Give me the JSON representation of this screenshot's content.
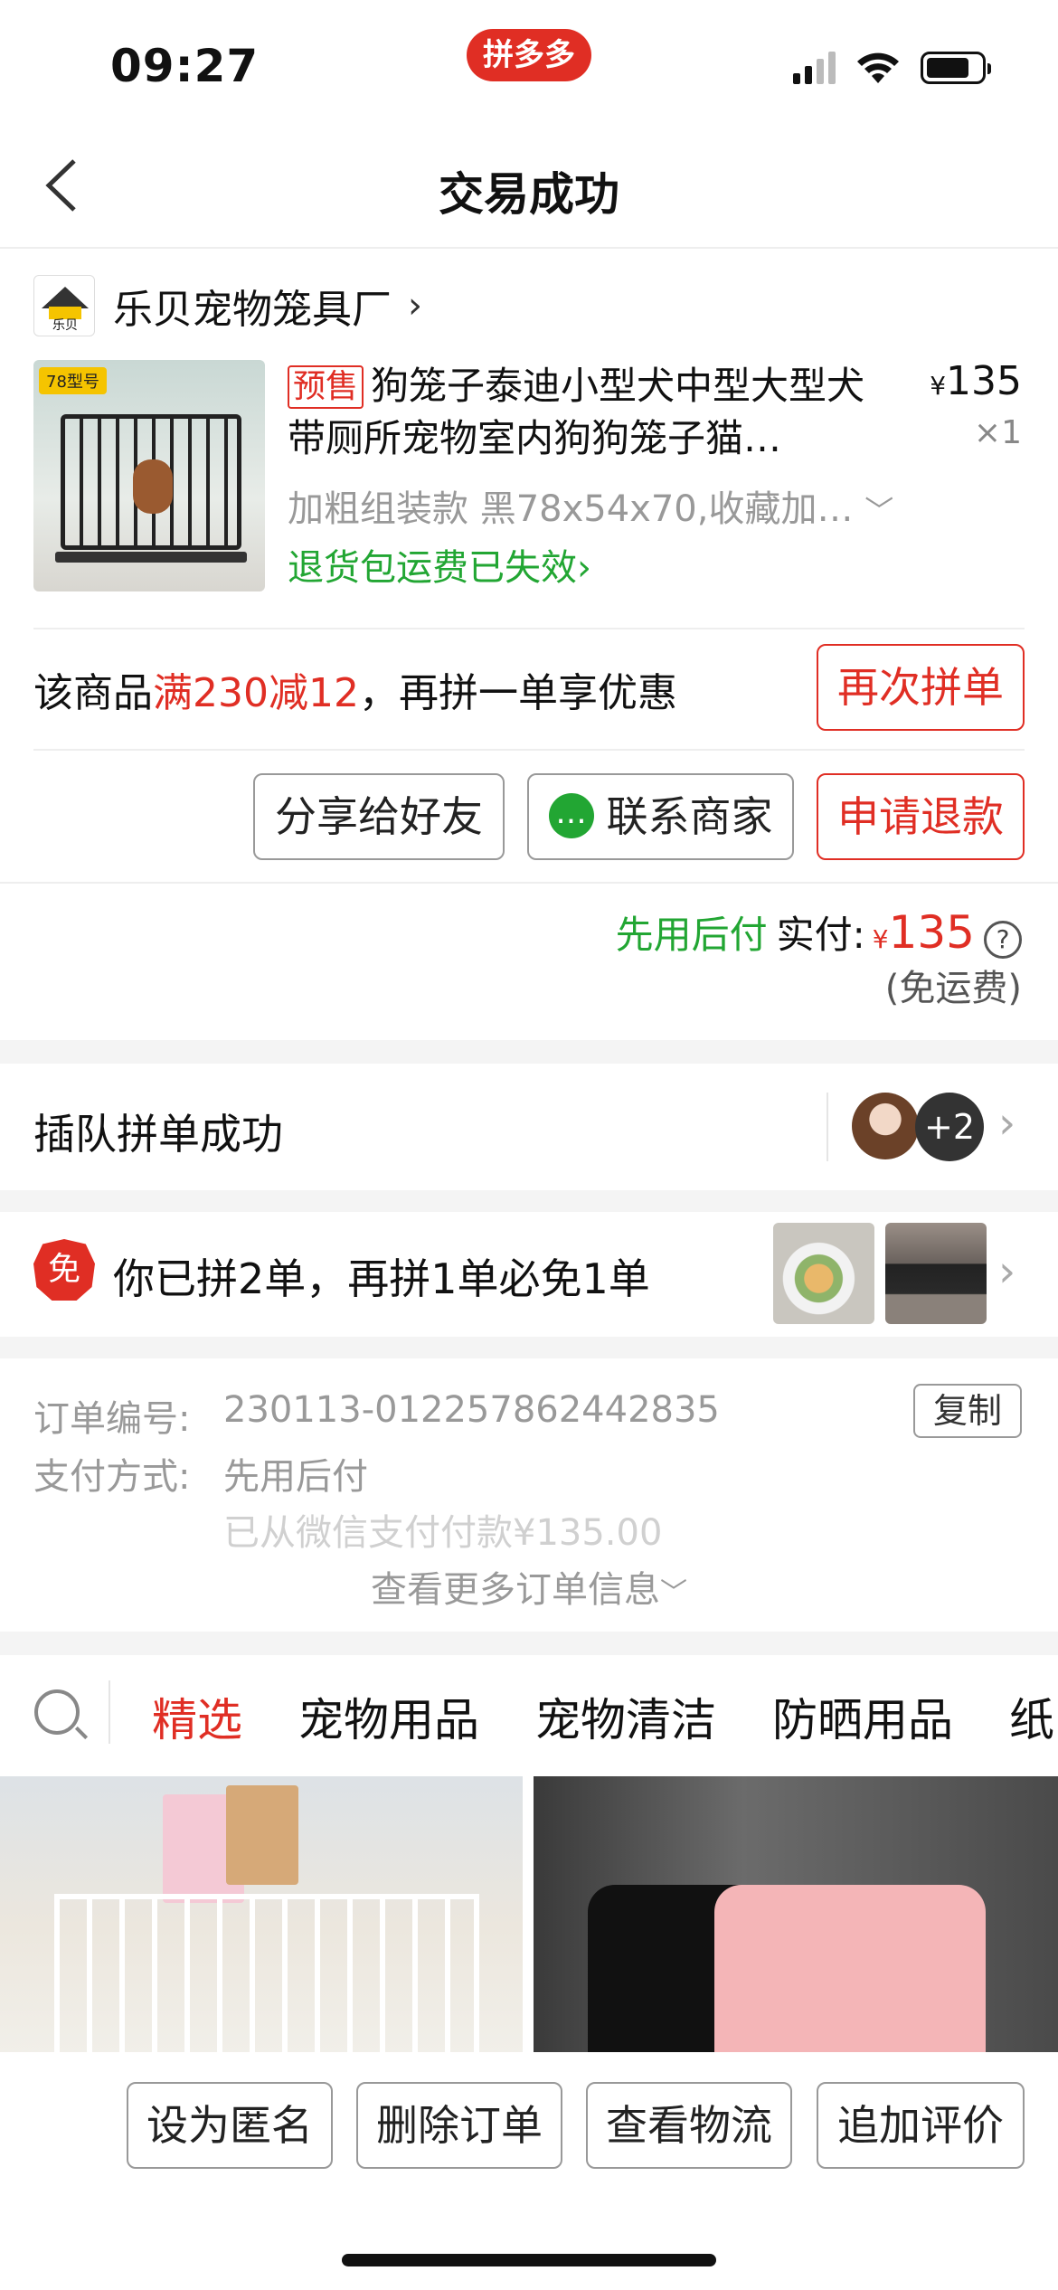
{
  "status_bar": {
    "time": "09:27",
    "app_badge": "拼多多"
  },
  "nav": {
    "title": "交易成功"
  },
  "store": {
    "name": "乐贝宠物笼具厂",
    "logo_text": "乐贝"
  },
  "product": {
    "image_tag": "78型号",
    "presale_tag": "预售",
    "title": "狗笼子泰迪小型犬中型大型犬带厕所宠物室内狗狗笼子猫…",
    "price": "135",
    "currency": "¥",
    "quantity": "×1",
    "spec": "加粗组装款 黑78x54x70,收藏加…",
    "refund_notice": "退货包运费已失效"
  },
  "promo": {
    "prefix": "该商品",
    "highlight": "满230减12",
    "suffix": "，再拼一单享优惠",
    "button": "再次拼单"
  },
  "actions": {
    "share": "分享给好友",
    "contact": "联系商家",
    "refund": "申请退款"
  },
  "payment": {
    "method_tag": "先用后付",
    "paid_label": "实付:",
    "currency": "¥",
    "amount": "135",
    "help": "?",
    "shipping": "(免运费)"
  },
  "group": {
    "title": "插队拼单成功",
    "extra_count": "+2"
  },
  "free_order": {
    "icon_text": "免",
    "text": "你已拼2单，再拼1单必免1单"
  },
  "order_info": {
    "order_no_label": "订单编号:",
    "order_no": "230113-012257862442835",
    "copy": "复制",
    "pay_method_label": "支付方式:",
    "pay_method": "先用后付",
    "pay_detail": "已从微信支付付款¥135.00",
    "more": "查看更多订单信息"
  },
  "tabs": [
    {
      "label": "精选",
      "active": true
    },
    {
      "label": "宠物用品",
      "active": false
    },
    {
      "label": "宠物清洁",
      "active": false
    },
    {
      "label": "防晒用品",
      "active": false
    },
    {
      "label": "纸",
      "active": false
    }
  ],
  "bottom_buttons": {
    "anonymous": "设为匿名",
    "delete": "删除订单",
    "logistics": "查看物流",
    "review": "追加评价"
  },
  "colors": {
    "accent": "#e02e24",
    "green": "#22a633"
  }
}
